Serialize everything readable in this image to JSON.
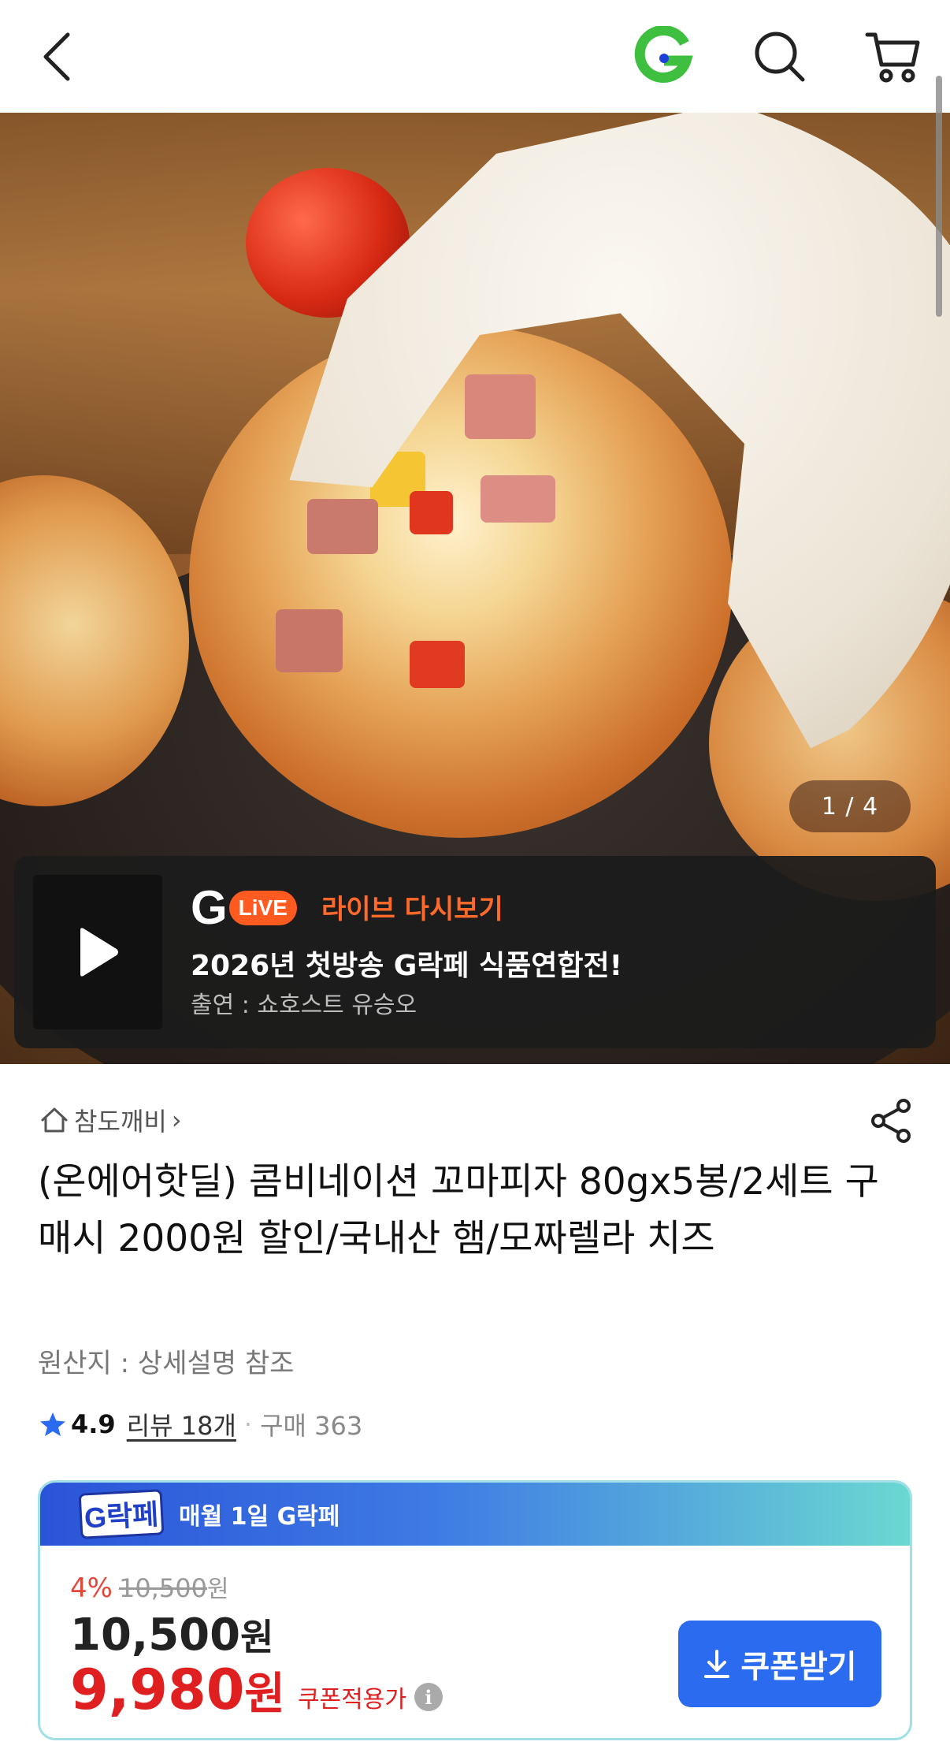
{
  "header": {
    "back_icon": "chevron-left-icon",
    "logo": "G",
    "search_icon": "search-icon",
    "cart_icon": "cart-icon"
  },
  "gallery": {
    "counter": "1 / 4"
  },
  "live": {
    "logo_g": "G",
    "logo_pill": "LiVE",
    "tag": "라이브 다시보기",
    "title": "2026년 첫방송 G락페 식품연합전!",
    "host": "출연 : 쇼호스트 유승오"
  },
  "store": {
    "name": "참도깨비",
    "chevron": "›"
  },
  "product": {
    "title": "(온에어핫딜) 콤비네이션 꼬마피자 80gx5봉/2세트 구매시 2000원 할인/국내산 햄/모짜렐라 치즈",
    "origin": "원산지 : 상세설명 참조",
    "rating": "4.9",
    "reviews": "리뷰 18개",
    "separator": "·",
    "purchases": "구매 363"
  },
  "coupon": {
    "logo_text": "G락페",
    "head_text": "매월 1일 G락페",
    "discount_pct": "4%",
    "original_price": "10,500",
    "original_won": "원",
    "price": "10,500",
    "price_won": "원",
    "coupon_price": "9,980",
    "coupon_won": "원",
    "coupon_price_label": "쿠폰적용가",
    "info_glyph": "i",
    "button_label": "쿠폰받기"
  },
  "colors": {
    "brand_green": "#3fbf3f",
    "accent_blue": "#2a6bef",
    "live_orange": "#ff5a1f",
    "price_red": "#e02020"
  }
}
